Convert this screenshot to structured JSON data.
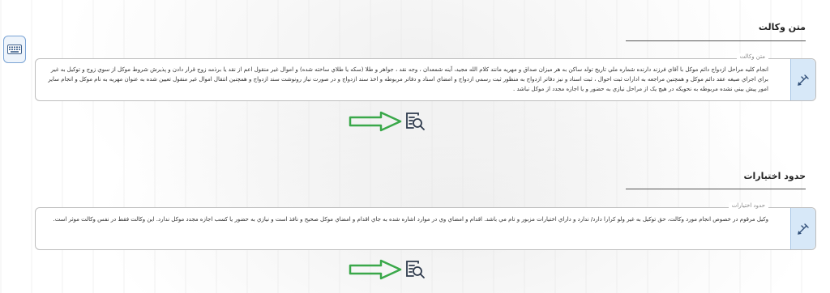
{
  "sections": [
    {
      "title": "متن وکالت",
      "legend": "متن وكالت",
      "text": "انجام کلیه مراحل ازدواج دائم موکل با آقاي  فرزند  دارنده شماره ملي  تاريخ تولد  ساكن  به هر ميزان صداق و مهريه مانند كلام الله مجيد، آينه شمعدان ، وجه نقد ، جواهر و طلا (سكه يا طلاي ساخته شده) و اموال غير منقول اعم از نقد يا برذمه زوج قرار دادن و پذيرش شروط موكل از سوي زوج و توكيل به غير براي اجراي صيغه عقد دائم موكل و همچنين مراجعه به ادارات ثبت احوال ، ثبت اسناد و نيز دفاتر ازدواج به منظور ثبت رسمي ازدواج و امضاي اسناد و دفاتر مربوطه و اخذ سند ازدواج و در صورت نياز رونوشت سند ازدواج و همچنين انتقال اموال غير منقول تعيين شده به عنوان مهريه به نام موكل و انجام ساير امور پيش بيني نشده مربوطه به نحويكه در هيچ يک از مراحل نيازي به حضور و يا اجازه مجدد از موكل نباشد ."
    },
    {
      "title": "حدود اختیارات",
      "legend": "حدود اختيارات",
      "text": "وكيل مرقوم در خصوص انجام مورد وكالت، حق توكيل به غير ولو كرارا دارد/ ندارد و داراي اختيارات مزبور و تام مي باشد. اقدام و امضاي وي در موارد اشاره شده به جاي اقدام و امضاي موكل صحيح و نافذ است و نيازي به حضور يا كسب اجازه مجدد موكل ندارد. اين وكالت فقط در نفس وكالت موثر است."
    }
  ],
  "icons": {
    "side": "keyboard-icon",
    "field": "contract-edit-icon",
    "zoom": "zoom-document-icon",
    "arrow": "right-arrow-icon"
  },
  "colors": {
    "arrow": "#3aa84a",
    "field_icon_bg": "#d7e8f8",
    "zoom": "#2f3b4d"
  }
}
